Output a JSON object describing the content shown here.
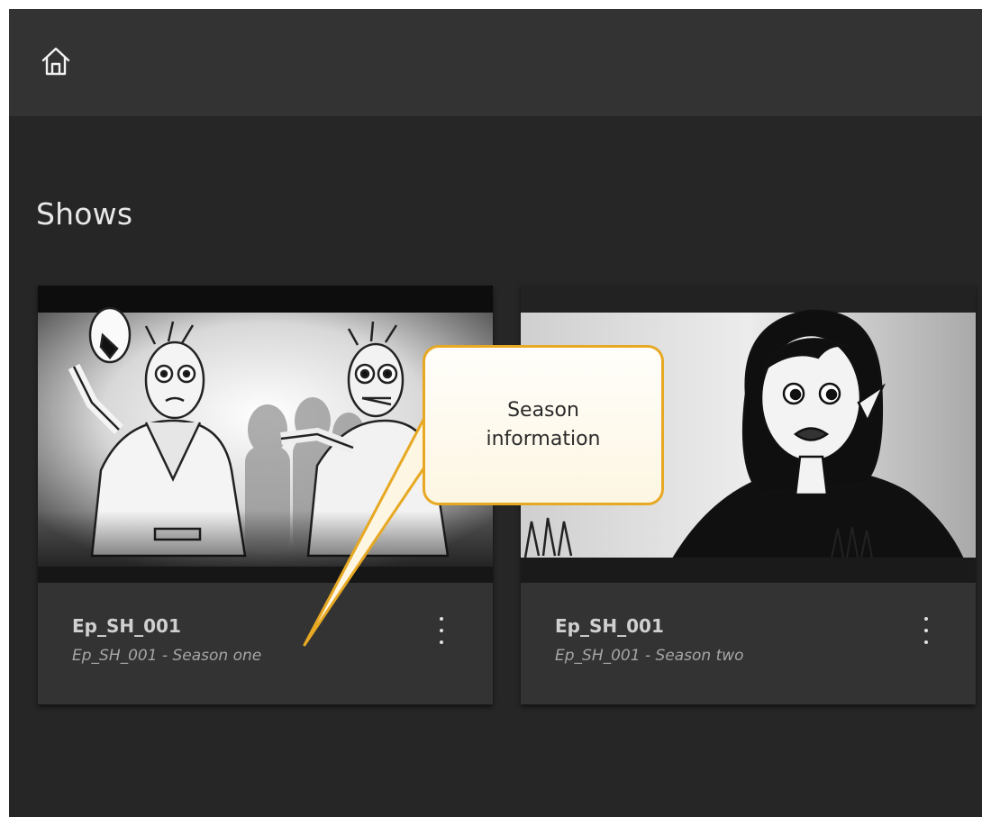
{
  "header": {
    "home_icon": "home-icon"
  },
  "page": {
    "title": "Shows"
  },
  "shows": [
    {
      "title": "Ep_SH_001",
      "subtitle": "Ep_SH_001 - Season one",
      "menu_icon": "more-vertical-icon",
      "thumbnail": "storyboard-zombies-image"
    },
    {
      "title": "Ep_SH_001",
      "subtitle": "Ep_SH_001 - Season two",
      "menu_icon": "more-vertical-icon",
      "thumbnail": "storyboard-girl-image"
    }
  ],
  "callout": {
    "line1": "Season",
    "line2": "information",
    "border_color": "#e7a823"
  },
  "colors": {
    "background": "#262626",
    "topbar": "#333333",
    "card": "#333333",
    "title_text": "#d0d0d0",
    "subtitle_text": "#a6a6a6"
  }
}
